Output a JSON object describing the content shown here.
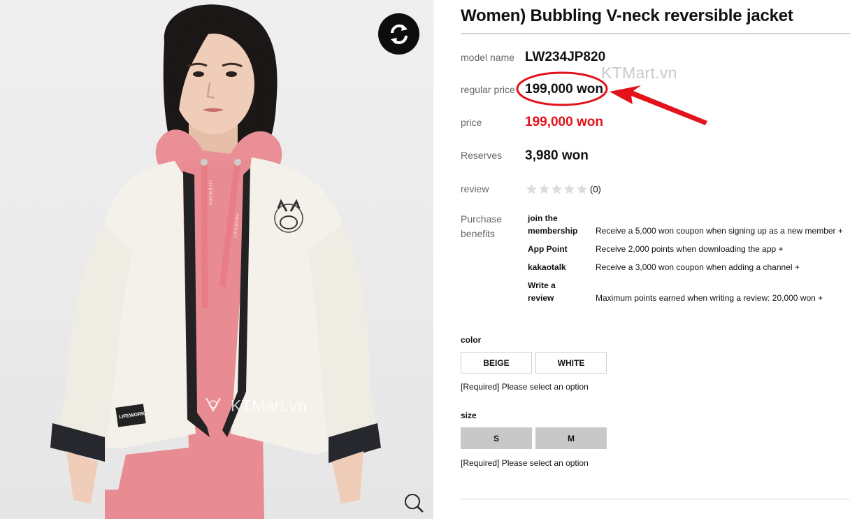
{
  "product": {
    "title": "Women) Bubbling V-neck reversible jacket"
  },
  "info": {
    "model_label": "model name",
    "model_value": "LW234JP820",
    "regular_price_label": "regular price",
    "regular_price_value": "199,000 won",
    "price_label": "price",
    "price_value": "199,000 won",
    "reserves_label": "Reserves",
    "reserves_value": "3,980 won",
    "review_label": "review",
    "review_count": "(0)",
    "rating": 0,
    "rating_max": 5
  },
  "benefits": {
    "label": "Purchase benefits",
    "items": [
      {
        "name": "join the membership",
        "desc": "Receive a 5,000 won coupon when signing up as a new member +"
      },
      {
        "name": "App Point",
        "desc": "Receive 2,000 points when downloading the app +"
      },
      {
        "name": "kakaotalk",
        "desc": "Receive a 3,000 won coupon when adding a channel +"
      },
      {
        "name": "Write a review",
        "desc": "Maximum points earned when writing a review: 20,000 won +"
      }
    ]
  },
  "options": {
    "color": {
      "title": "color",
      "values": [
        "BEIGE",
        "WHITE"
      ],
      "required_text": "[Required] Please select an option"
    },
    "size": {
      "title": "size",
      "values": [
        "S",
        "M"
      ],
      "required_text": "[Required] Please select an option"
    }
  },
  "watermark": "KTMart.vn",
  "garment_labels": {
    "tag": "LIFEWORK",
    "drawstring": "LIFEWORK"
  },
  "icons": {
    "rotate": "rotate-icon",
    "zoom": "zoom-icon",
    "star": "star-icon",
    "arrow": "arrow-annotation"
  },
  "colors": {
    "accent_red": "#e1121a",
    "annotation_red": "#e3121b",
    "label_gray": "#666666",
    "option_gray": "#c8c8c8"
  }
}
